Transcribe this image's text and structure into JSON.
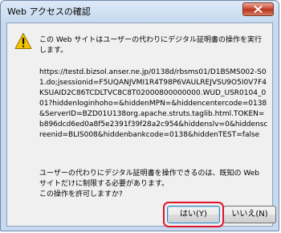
{
  "window": {
    "title": "Web アクセスの確認"
  },
  "dialog": {
    "message": "この Web サイトはユーザーの代わりにデジタル証明書の操作を実行します。",
    "url": "https://testd.bizsol.anser.ne.jp/0138d/rbsms01/D1BSMS002-S01.do;jsessionid=F5UQANJVMI1R4T98P6VAULREJVSU9O5I0V7F4KSUAID2C86TCDLTVC8C8T02000800000000.WUD_USR0104_001?hiddenloginhoho=&hiddenMPN=&hiddencentercode=0138&ServerID=BZD01U138org.apache.struts.taglib.html.TOKEN=b896dcd6ed0a8f5e2391f39f28a2c954&hiddenslv=0&hiddenscreenid=BLIS008&hiddenbankcode=0138&hiddenTEST=false",
    "question_line1": "ユーザーの代わりにデジタル証明書を操作できるのは、既知の Web サイトだけに制限する必要があります。",
    "question_line2": "この操作を許可しますか?"
  },
  "buttons": {
    "yes_label": "はい(Y)",
    "no_label": "いいえ(N)"
  },
  "colors": {
    "highlight": "#e0142a",
    "close_button": "#c8442a",
    "warning": "#f5c400"
  },
  "icons": {
    "warning": "warning-icon",
    "close": "close-icon"
  }
}
